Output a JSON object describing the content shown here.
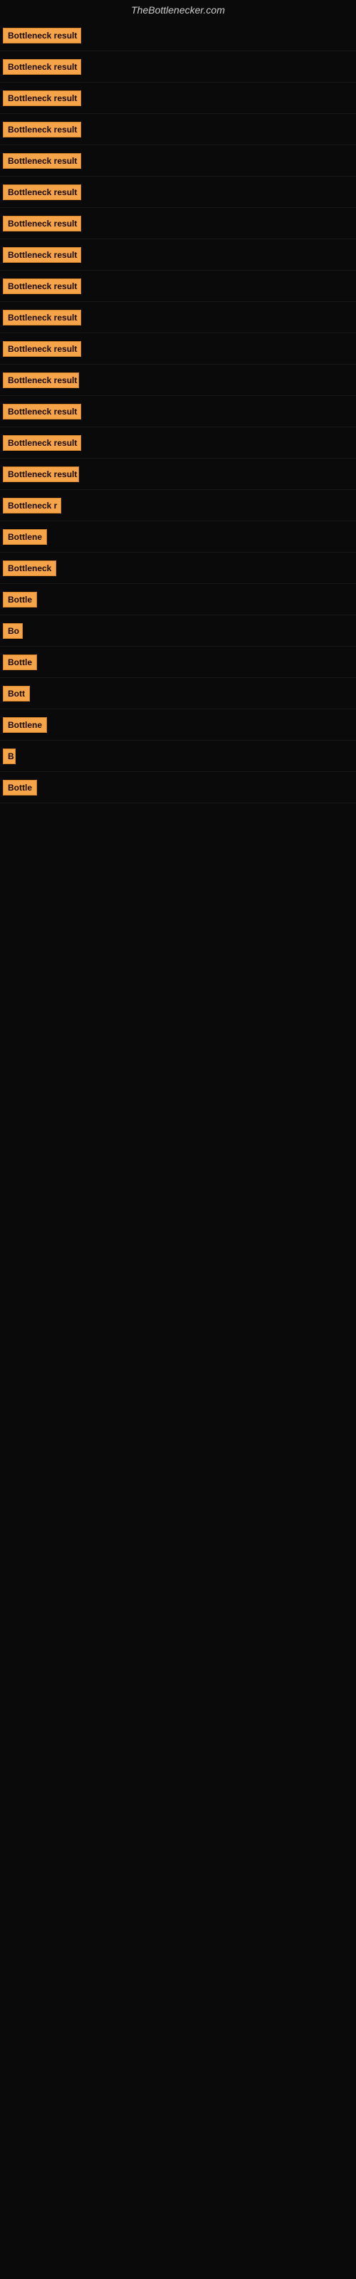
{
  "site": {
    "title": "TheBottlenecker.com"
  },
  "badges": [
    {
      "id": 1,
      "label": "Bottleneck result",
      "width": 110
    },
    {
      "id": 2,
      "label": "Bottleneck result",
      "width": 110
    },
    {
      "id": 3,
      "label": "Bottleneck result",
      "width": 110
    },
    {
      "id": 4,
      "label": "Bottleneck result",
      "width": 110
    },
    {
      "id": 5,
      "label": "Bottleneck result",
      "width": 110
    },
    {
      "id": 6,
      "label": "Bottleneck result",
      "width": 110
    },
    {
      "id": 7,
      "label": "Bottleneck result",
      "width": 110
    },
    {
      "id": 8,
      "label": "Bottleneck result",
      "width": 110
    },
    {
      "id": 9,
      "label": "Bottleneck result",
      "width": 110
    },
    {
      "id": 10,
      "label": "Bottleneck result",
      "width": 110
    },
    {
      "id": 11,
      "label": "Bottleneck result",
      "width": 110
    },
    {
      "id": 12,
      "label": "Bottleneck result",
      "width": 107
    },
    {
      "id": 13,
      "label": "Bottleneck result",
      "width": 110
    },
    {
      "id": 14,
      "label": "Bottleneck result",
      "width": 110
    },
    {
      "id": 15,
      "label": "Bottleneck result",
      "width": 107
    },
    {
      "id": 16,
      "label": "Bottleneck r",
      "width": 82
    },
    {
      "id": 17,
      "label": "Bottlene",
      "width": 68
    },
    {
      "id": 18,
      "label": "Bottleneck",
      "width": 75
    },
    {
      "id": 19,
      "label": "Bottle",
      "width": 52
    },
    {
      "id": 20,
      "label": "Bo",
      "width": 28
    },
    {
      "id": 21,
      "label": "Bottle",
      "width": 52
    },
    {
      "id": 22,
      "label": "Bott",
      "width": 38
    },
    {
      "id": 23,
      "label": "Bottlene",
      "width": 68
    },
    {
      "id": 24,
      "label": "B",
      "width": 18
    },
    {
      "id": 25,
      "label": "Bottle",
      "width": 52
    }
  ]
}
